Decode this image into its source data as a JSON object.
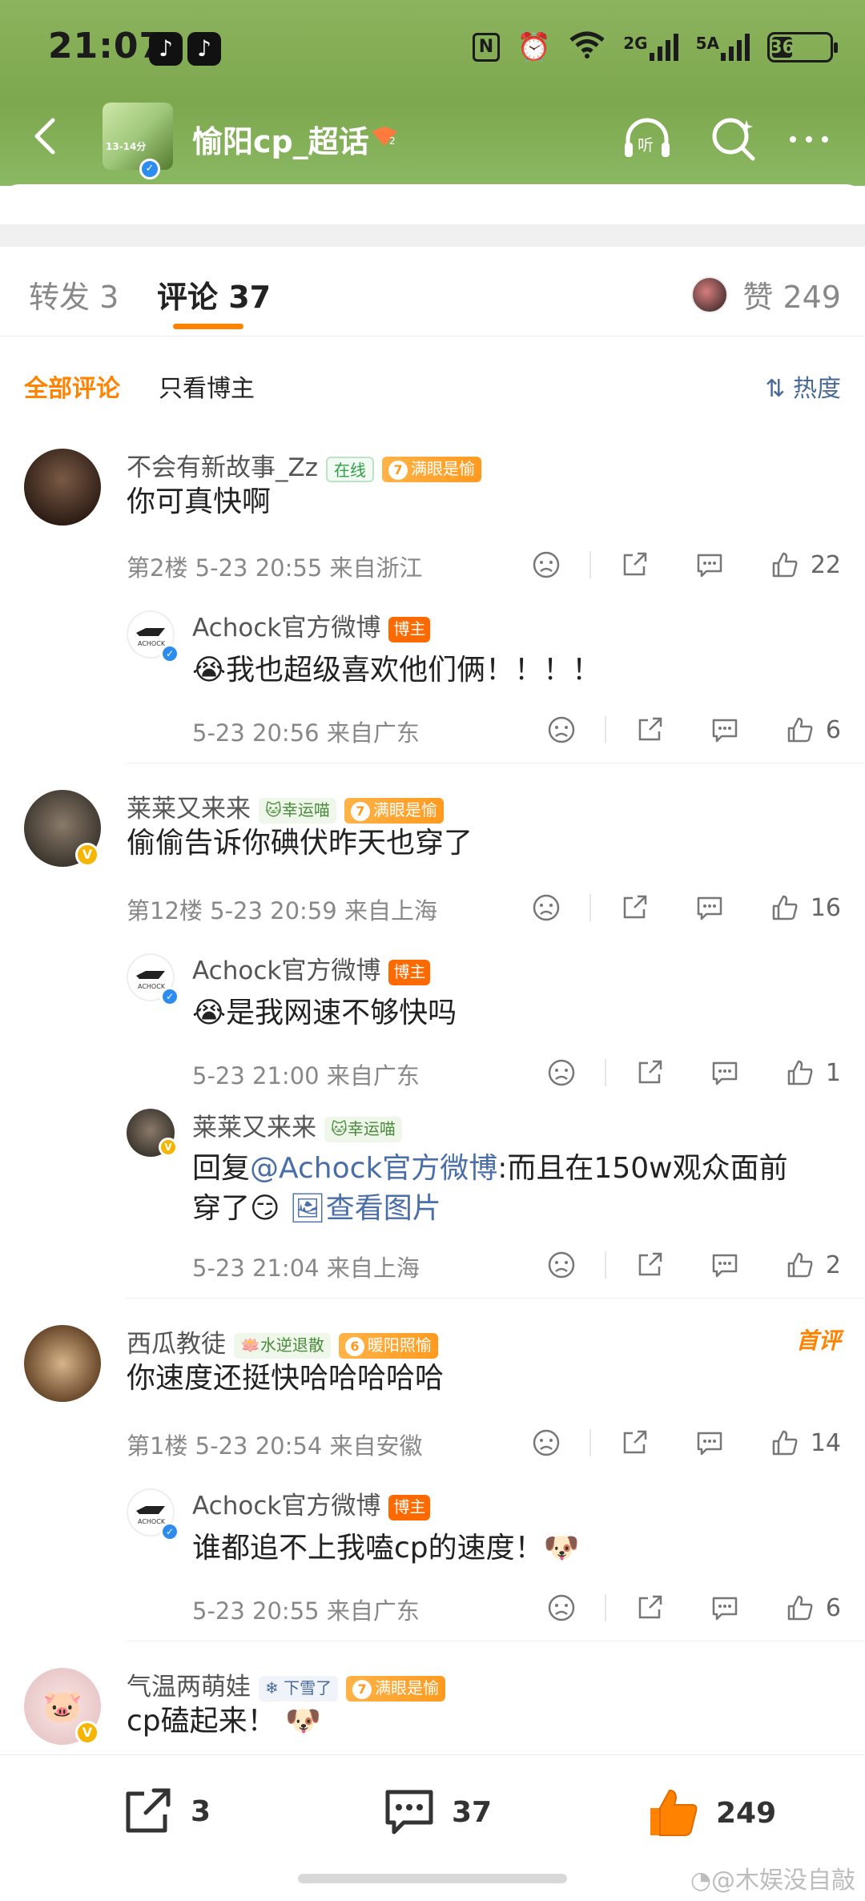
{
  "status_bar": {
    "time": "21:07",
    "network_label_1": "2G",
    "network_label_2": "5A",
    "wifi_label": "6",
    "battery": "36"
  },
  "nav": {
    "title": "愉阳cp_超话",
    "thumb_text": "13-14分"
  },
  "tabs": {
    "repost": "转发 3",
    "comments": "评论 37",
    "likes": "赞 249"
  },
  "filters": {
    "all": "全部评论",
    "host_only": "只看博主",
    "sort": "热度"
  },
  "comments": [
    {
      "name": "不会有新故事_Zz",
      "tag_online": "在线",
      "fan_level": "7",
      "fan_tag": "满眼是愉",
      "text": "你可真快啊",
      "meta": "第2楼  5-23 20:55  来自浙江",
      "likes": "22",
      "reply": {
        "name": "Achock官方微博",
        "host_tag": "博主",
        "text": "我也超级喜欢他们俩！！！！",
        "meta": "5-23 20:56  来自广东",
        "likes": "6"
      }
    },
    {
      "name": "莱莱又来来",
      "lucky_tag": "幸运喵",
      "fan_level": "7",
      "fan_tag": "满眼是愉",
      "text": "偷偷告诉你碘伏昨天也穿了",
      "meta": "第12楼  5-23 20:59  来自上海",
      "likes": "16",
      "replies": [
        {
          "name": "Achock官方微博",
          "host_tag": "博主",
          "text": "是我网速不够快吗",
          "meta": "5-23 21:00  来自广东",
          "likes": "1"
        },
        {
          "name": "莱莱又来来",
          "lucky_tag": "幸运喵",
          "reply_prefix": "回复",
          "mention": "@Achock官方微博",
          "text_line1": ":而且在150w观众面前",
          "text_line2": "穿了",
          "view_image": "查看图片",
          "meta": "5-23 21:04  来自上海",
          "likes": "2"
        }
      ]
    },
    {
      "name": "西瓜教徒",
      "green_tag": "水逆退散",
      "fan_level": "6",
      "fan_tag": "暖阳照愉",
      "first_review": "首评",
      "text": "你速度还挺快哈哈哈哈哈",
      "meta": "第1楼  5-23 20:54  来自安徽",
      "likes": "14",
      "reply": {
        "name": "Achock官方微博",
        "host_tag": "博主",
        "text": "谁都追不上我嗑cp的速度！",
        "meta": "5-23 20:55  来自广东",
        "likes": "6"
      }
    },
    {
      "name": "气温两萌娃",
      "snow_tag": "下雪了",
      "fan_level": "7",
      "fan_tag": "满眼是愉",
      "text": "cp磕起来！"
    }
  ],
  "bottom_bar": {
    "reposts": "3",
    "comments": "37",
    "likes": "249"
  },
  "watermark": "@木娱没自敲",
  "colors": {
    "accent": "#ff8200",
    "header_green": "#8cb35e",
    "link": "#4a6ea8"
  }
}
